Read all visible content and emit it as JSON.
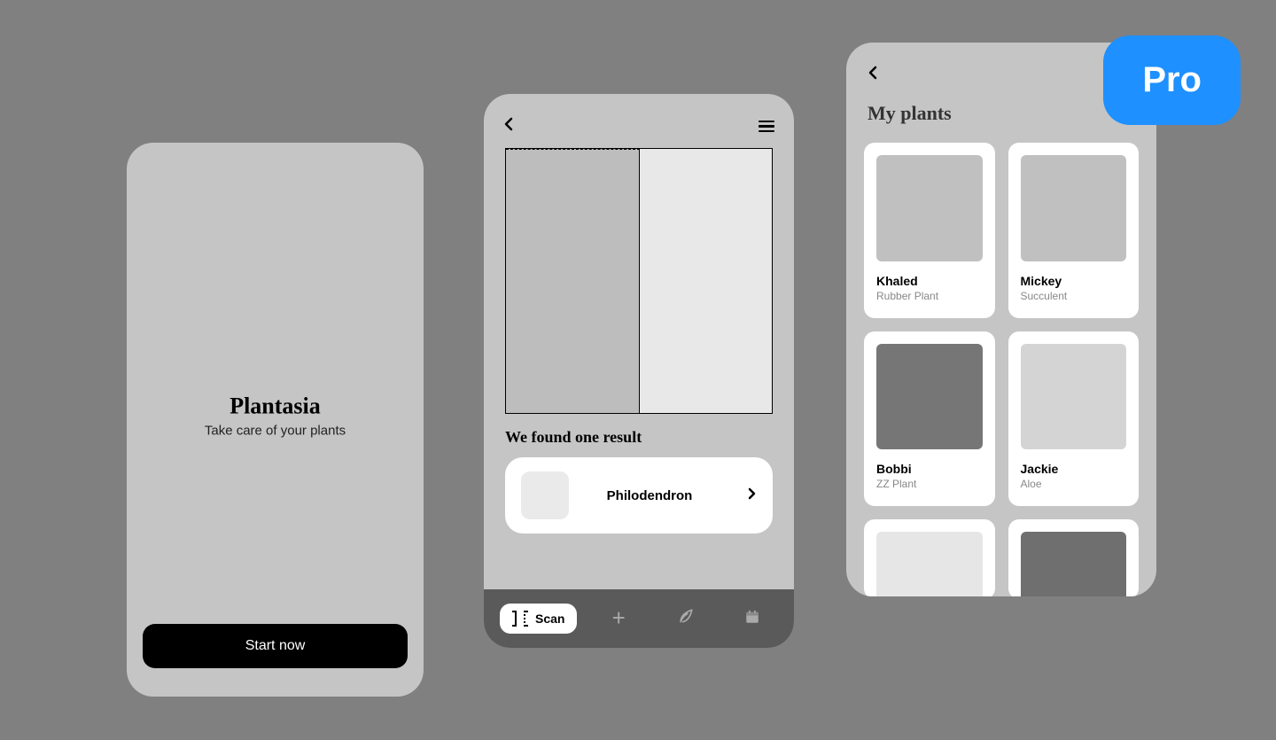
{
  "welcome": {
    "title": "Plantasia",
    "subtitle": "Take care of your plants",
    "start_button": "Start now"
  },
  "scan": {
    "result_heading": "We found one result",
    "result": {
      "name": "Philodendron"
    },
    "nav": {
      "scan_label": "Scan"
    }
  },
  "plants": {
    "title": "My plants",
    "items": [
      {
        "name": "Khaled",
        "species": "Rubber Plant",
        "color": "#c0c0c0"
      },
      {
        "name": "Mickey",
        "species": "Succulent",
        "color": "#c0c0c0"
      },
      {
        "name": "Bobbi",
        "species": "ZZ Plant",
        "color": "#767676"
      },
      {
        "name": "Jackie",
        "species": "Aloe",
        "color": "#d4d4d4"
      }
    ],
    "partial_colors": [
      "#e6e6e6",
      "#6f6f6f"
    ]
  },
  "pro_badge": "Pro"
}
